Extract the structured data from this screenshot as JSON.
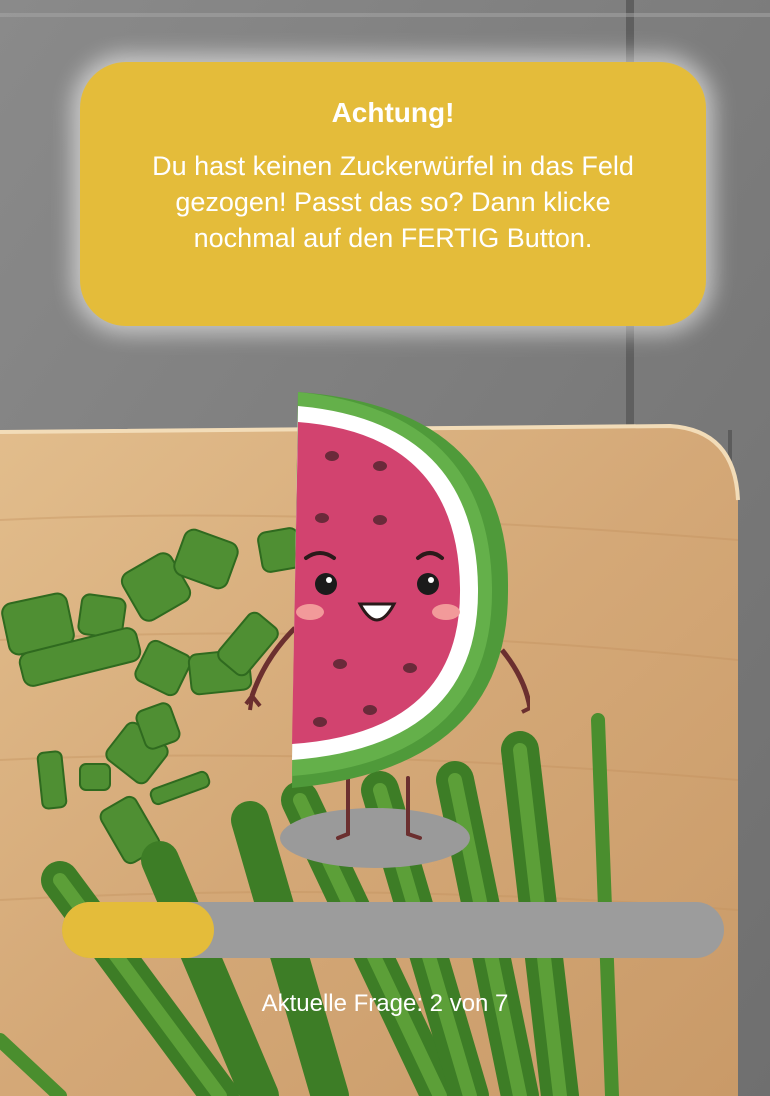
{
  "alert": {
    "title": "Achtung!",
    "message": "Du hast keinen Zuckerwürfel in das Feld gezogen! Passt das so? Dann klicke nochmal auf den FERTIG Button."
  },
  "progress": {
    "label": "Aktuelle Frage: 2 von 7",
    "current": 2,
    "total": 7,
    "fill_fraction": 0.23
  },
  "colors": {
    "accent": "#e4bc3a",
    "track": "#9c9c9c",
    "text": "#ffffff"
  },
  "icons": {
    "mascot": "watermelon-mascot-icon"
  }
}
